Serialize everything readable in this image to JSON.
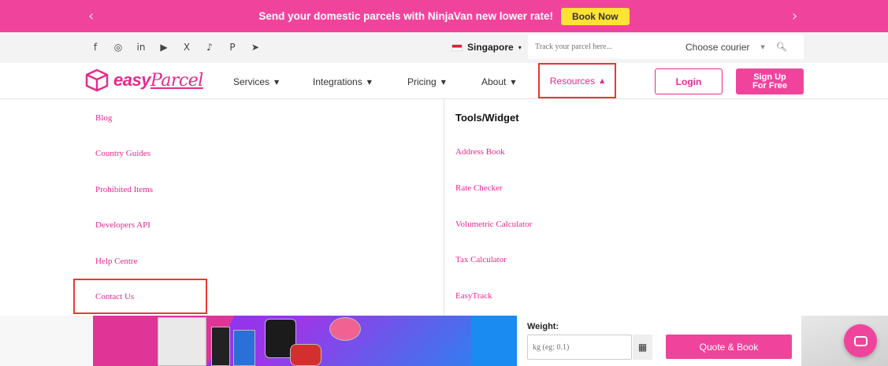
{
  "promo": {
    "text": "Send your domestic parcels with NinjaVan new lower rate!",
    "button": "Book Now"
  },
  "topbar": {
    "social": [
      "f",
      "◎",
      "in",
      "▶",
      "X",
      "♪",
      "P",
      "➤"
    ],
    "country": "Singapore",
    "track_placeholder": "Track your parcel here...",
    "courier": "Choose courier"
  },
  "nav": {
    "logo": {
      "easy": "easy",
      "parcel": "Parcel"
    },
    "items": [
      {
        "label": "Services"
      },
      {
        "label": "Integrations"
      },
      {
        "label": "Pricing"
      },
      {
        "label": "About"
      }
    ],
    "resources": "Resources",
    "login": "Login",
    "signup": "Sign Up\nFor Free"
  },
  "mega": {
    "left": [
      "Blog",
      "Country Guides",
      "Prohibited Items",
      "Developers API",
      "Help Centre",
      "Contact Us"
    ],
    "tools_title": "Tools/Widget",
    "right": [
      "Address Book",
      "Rate Checker",
      "Volumetric Calculator",
      "Tax Calculator",
      "EasyTrack"
    ]
  },
  "quote": {
    "weight_label": "Weight:",
    "weight_placeholder": "kg (eg: 0.1)",
    "button": "Quote & Book"
  },
  "colors": {
    "brand": "#f0449c",
    "highlight": "#e53935",
    "book_now": "#ffe234"
  }
}
